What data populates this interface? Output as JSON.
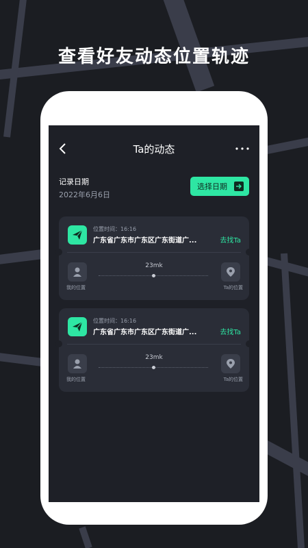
{
  "headline": "查看好友动态位置轨迹",
  "nav": {
    "title": "Ta的动态",
    "back_icon": "chevron-left-icon",
    "more_icon": "more-dots-icon"
  },
  "record": {
    "label": "记录日期",
    "date": "2022年6月6日",
    "select_button": "选择日期"
  },
  "cards": [
    {
      "time": "位置时间：16:16",
      "address": "广东省广东市广东区广东街道广...",
      "find_label": "去找Ta",
      "distance": "23mk",
      "my_label": "我的位置",
      "ta_label": "Ta的位置"
    },
    {
      "time": "位置时间：16:16",
      "address": "广东省广东市广东区广东街道广...",
      "find_label": "去找Ta",
      "distance": "23mk",
      "my_label": "我的位置",
      "ta_label": "Ta的位置"
    }
  ],
  "colors": {
    "accent": "#2ee6a3",
    "background": "#1b1d22",
    "card": "#2a2d37"
  }
}
